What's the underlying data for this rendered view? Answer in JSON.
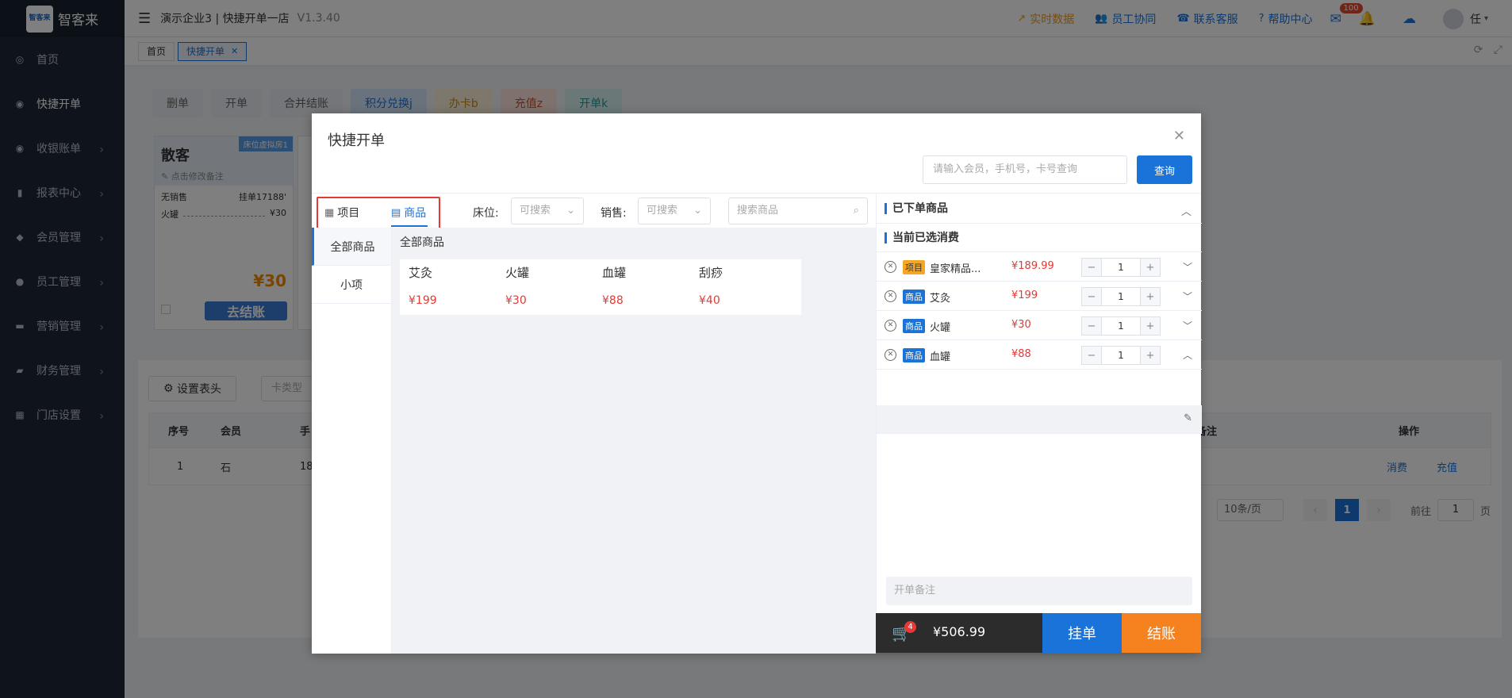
{
  "app": {
    "logo_text": "智客来",
    "logo_mark": "智客来",
    "title": "演示企业3 | 快捷开单一店",
    "version": "V1.3.40"
  },
  "sidebar": {
    "items": [
      {
        "label": "首页",
        "icon": "dashboard-icon",
        "has_chevron": false
      },
      {
        "label": "快捷开单",
        "icon": "bag-icon",
        "has_chevron": false
      },
      {
        "label": "收银账单",
        "icon": "money-bag-icon",
        "has_chevron": true
      },
      {
        "label": "报表中心",
        "icon": "bar-chart-icon",
        "has_chevron": true
      },
      {
        "label": "会员管理",
        "icon": "diamond-icon",
        "has_chevron": true
      },
      {
        "label": "员工管理",
        "icon": "user-icon",
        "has_chevron": true
      },
      {
        "label": "营销管理",
        "icon": "briefcase-icon",
        "has_chevron": true
      },
      {
        "label": "财务管理",
        "icon": "wallet-icon",
        "has_chevron": true
      },
      {
        "label": "门店设置",
        "icon": "grid-icon",
        "has_chevron": true
      }
    ]
  },
  "topbar": {
    "links": [
      {
        "label": "实时数据",
        "icon": "trend-icon",
        "color": "#f09a24"
      },
      {
        "label": "员工协同",
        "icon": "team-icon",
        "color": "#1a73d9"
      },
      {
        "label": "联系客服",
        "icon": "phone-icon",
        "color": "#1a73d9"
      },
      {
        "label": "帮助中心",
        "icon": "help-icon",
        "color": "#1a73d9"
      }
    ],
    "mail_badge": "100",
    "user_name": "任"
  },
  "tabs": [
    {
      "label": "首页",
      "active": false
    },
    {
      "label": "快捷开单",
      "active": true
    }
  ],
  "background": {
    "actions": [
      "删单",
      "开单",
      "合并结账",
      "积分兑换j",
      "办卡b",
      "充值z",
      "开单k"
    ],
    "card": {
      "title": "散客",
      "edit_note": "点击修改备注",
      "tag": "床位虚拟房1",
      "seller": "无销售",
      "hang": "挂单17188'",
      "item_name": "火罐",
      "item_price": "¥30",
      "total": "¥30",
      "settle": "去结账"
    },
    "set_header": "设置表头",
    "card_type_placeholder": "卡类型",
    "table": {
      "headers": [
        "序号",
        "会员",
        "手",
        "备注",
        "操作"
      ],
      "row": {
        "index": "1",
        "member": "石",
        "phone": "18",
        "consume": "消费",
        "recharge": "充值"
      }
    },
    "pager": {
      "page_size": "10条/页",
      "current": "1",
      "goto_prefix": "前往",
      "goto_value": "1",
      "goto_suffix": "页"
    }
  },
  "modal": {
    "title": "快捷开单",
    "member_search_placeholder": "请输入会员，手机号，卡号查询",
    "query_label": "查询",
    "segments": [
      {
        "label": "项目",
        "active": false
      },
      {
        "label": "商品",
        "active": true
      }
    ],
    "bed_label": "床位:",
    "bed_placeholder": "可搜索",
    "sales_label": "销售:",
    "sales_placeholder": "可搜索",
    "goods_search_placeholder": "搜索商品",
    "categories": [
      {
        "label": "全部商品",
        "active": true
      },
      {
        "label": "小项",
        "active": false
      }
    ],
    "goods_header": "全部商品",
    "goods": [
      {
        "name": "艾灸",
        "price": "¥199"
      },
      {
        "name": "火罐",
        "price": "¥30"
      },
      {
        "name": "血罐",
        "price": "¥88"
      },
      {
        "name": "刮痧",
        "price": "¥40"
      }
    ],
    "ordered_title": "已下单商品",
    "current_title": "当前已选消费",
    "order_items": [
      {
        "type": "项目",
        "type_kind": "proj",
        "name": "皇家精品...",
        "price": "¥189.99",
        "qty": "1",
        "expanded": false
      },
      {
        "type": "商品",
        "type_kind": "goods",
        "name": "艾灸",
        "price": "¥199",
        "qty": "1",
        "expanded": false
      },
      {
        "type": "商品",
        "type_kind": "goods",
        "name": "火罐",
        "price": "¥30",
        "qty": "1",
        "expanded": false
      },
      {
        "type": "商品",
        "type_kind": "goods",
        "name": "血罐",
        "price": "¥88",
        "qty": "1",
        "expanded": true
      }
    ],
    "remark_placeholder": "开单备注",
    "cart_count": "4",
    "cart_total": "¥506.99",
    "hang_label": "挂单",
    "pay_label": "结账"
  }
}
